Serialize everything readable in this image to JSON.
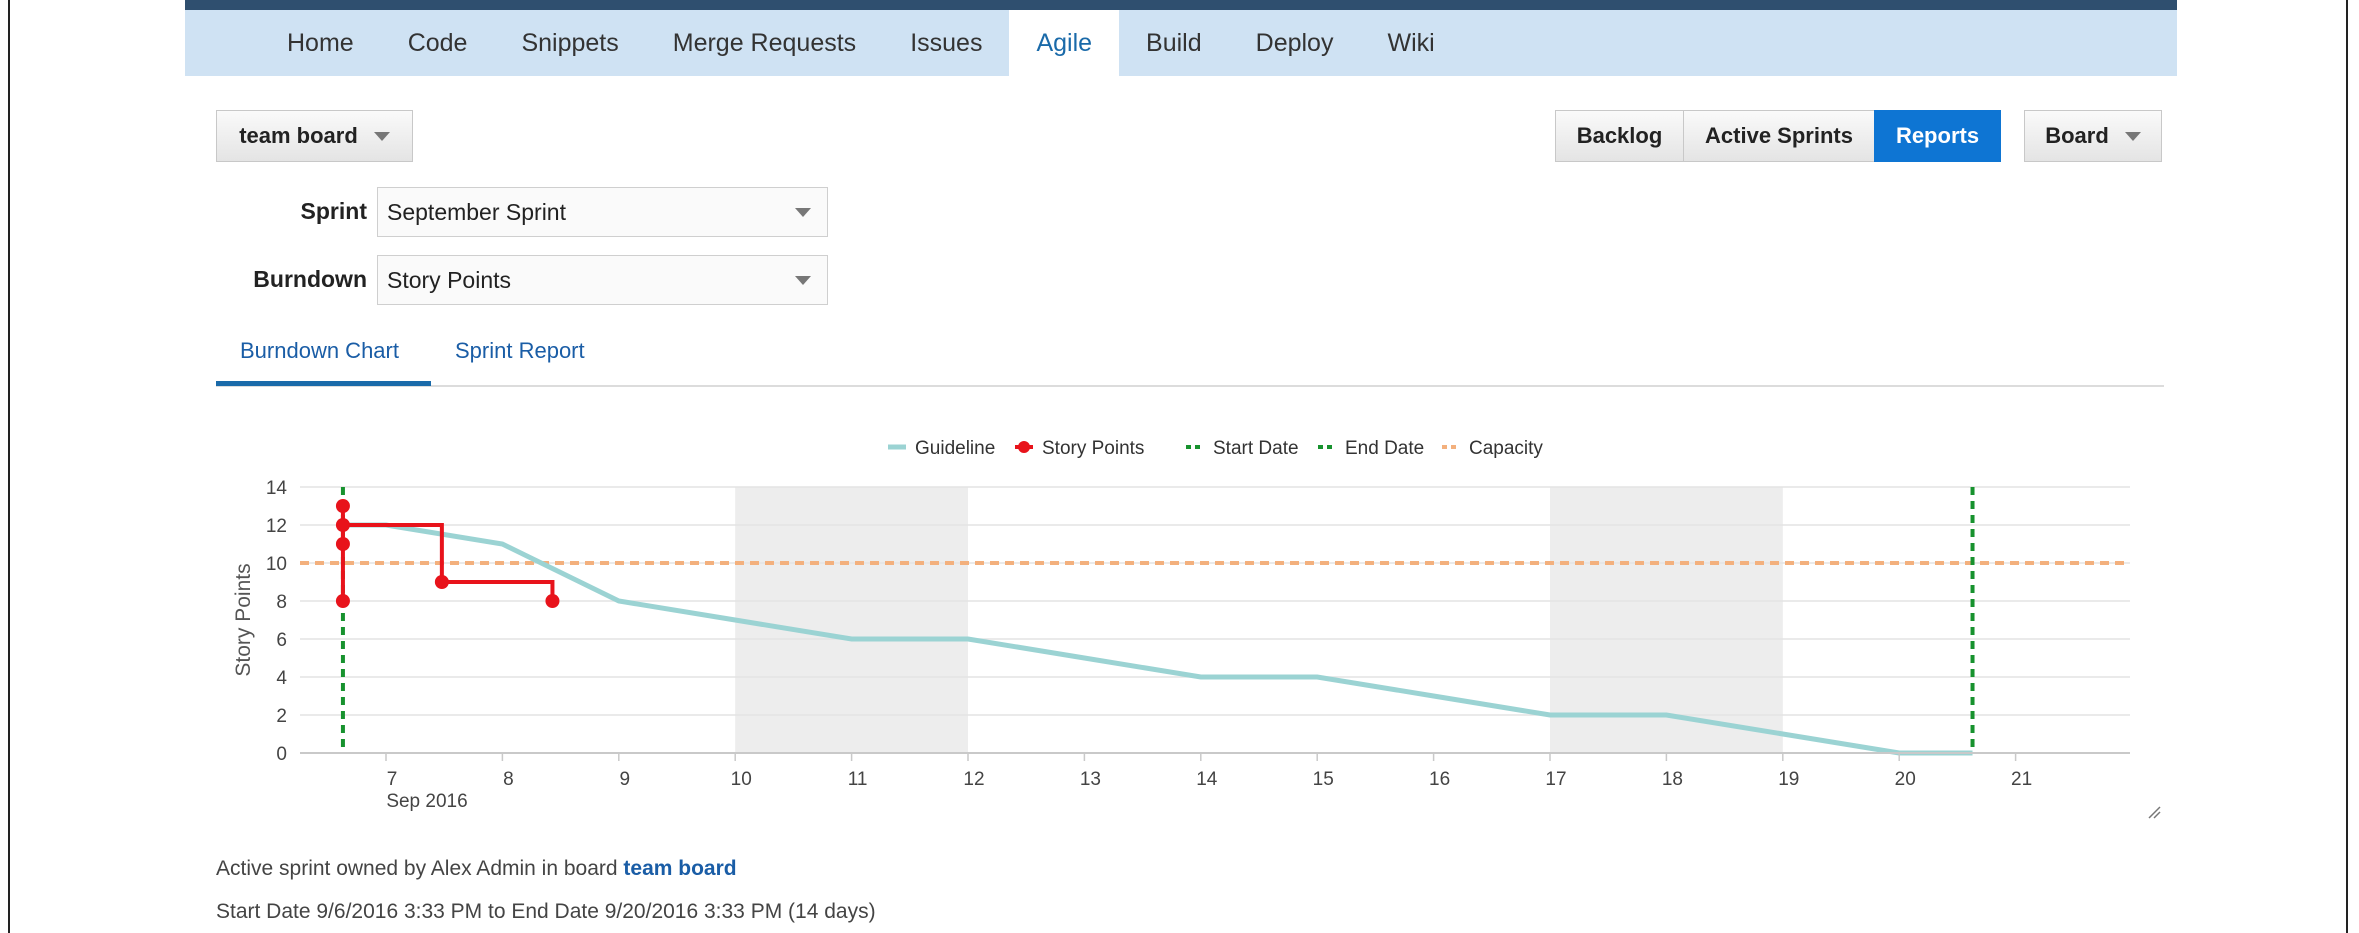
{
  "nav": {
    "items": [
      {
        "label": "Home",
        "active": false
      },
      {
        "label": "Code",
        "active": false
      },
      {
        "label": "Snippets",
        "active": false
      },
      {
        "label": "Merge Requests",
        "active": false
      },
      {
        "label": "Issues",
        "active": false
      },
      {
        "label": "Agile",
        "active": true
      },
      {
        "label": "Build",
        "active": false
      },
      {
        "label": "Deploy",
        "active": false
      },
      {
        "label": "Wiki",
        "active": false
      }
    ]
  },
  "toolbar": {
    "board_selector": "team board",
    "backlog": "Backlog",
    "active_sprints": "Active Sprints",
    "reports": "Reports",
    "board_menu": "Board"
  },
  "filters": {
    "sprint_label": "Sprint",
    "sprint_value": "September Sprint",
    "burndown_label": "Burndown",
    "burndown_value": "Story Points"
  },
  "tabs": {
    "burndown_chart": "Burndown Chart",
    "sprint_report": "Sprint Report"
  },
  "chart_data": {
    "type": "line",
    "ylabel": "Story Points",
    "xlabel_sub": "Sep 2016",
    "ylim": [
      0,
      14
    ],
    "yticks": [
      0,
      2,
      4,
      6,
      8,
      10,
      12,
      14
    ],
    "xticks": [
      "7",
      "8",
      "9",
      "10",
      "11",
      "12",
      "13",
      "14",
      "15",
      "16",
      "17",
      "18",
      "19",
      "20",
      "21"
    ],
    "legend": [
      "Guideline",
      "Story Points",
      "Start Date",
      "End Date",
      "Capacity"
    ],
    "legend_position": "top-center",
    "grid": true,
    "colors": {
      "guideline": "#9bd3d3",
      "story_points": "#e8131b",
      "start_date": "#17922e",
      "end_date": "#17922e",
      "capacity": "#f3b07d",
      "weekend": "#ededed"
    },
    "weekends": [
      [
        10,
        12
      ],
      [
        17,
        19
      ]
    ],
    "capacity": 10,
    "start_date": 6.63,
    "end_date": 20.63,
    "guideline": [
      {
        "x": 6.63,
        "y": 12
      },
      {
        "x": 7,
        "y": 12
      },
      {
        "x": 8,
        "y": 11
      },
      {
        "x": 9,
        "y": 8
      },
      {
        "x": 10,
        "y": 7
      },
      {
        "x": 11,
        "y": 6
      },
      {
        "x": 12,
        "y": 6
      },
      {
        "x": 13,
        "y": 5
      },
      {
        "x": 14,
        "y": 4
      },
      {
        "x": 15,
        "y": 4
      },
      {
        "x": 16,
        "y": 3
      },
      {
        "x": 17,
        "y": 2
      },
      {
        "x": 18,
        "y": 2
      },
      {
        "x": 19,
        "y": 1
      },
      {
        "x": 20,
        "y": 0
      },
      {
        "x": 20.63,
        "y": 0
      }
    ],
    "story_points_steps": [
      {
        "x": 6.63,
        "y": 13
      },
      {
        "x": 6.63,
        "y": 12
      },
      {
        "x": 6.63,
        "y": 11
      },
      {
        "x": 6.63,
        "y": 8
      },
      {
        "x": 6.63,
        "y": 12
      },
      {
        "x": 7.48,
        "y": 12
      },
      {
        "x": 7.48,
        "y": 9
      },
      {
        "x": 8.43,
        "y": 9
      },
      {
        "x": 8.43,
        "y": 8
      }
    ],
    "story_points_markers": [
      {
        "x": 6.63,
        "y": 13
      },
      {
        "x": 6.63,
        "y": 12
      },
      {
        "x": 6.63,
        "y": 11
      },
      {
        "x": 6.63,
        "y": 8
      },
      {
        "x": 7.48,
        "y": 9
      },
      {
        "x": 8.43,
        "y": 8
      }
    ]
  },
  "footer": {
    "owner_text": "Active sprint owned by Alex Admin in board",
    "board_link": "team board",
    "dates_text": "Start Date 9/6/2016 3:33 PM to End Date 9/20/2016 3:33 PM (14 days)"
  }
}
